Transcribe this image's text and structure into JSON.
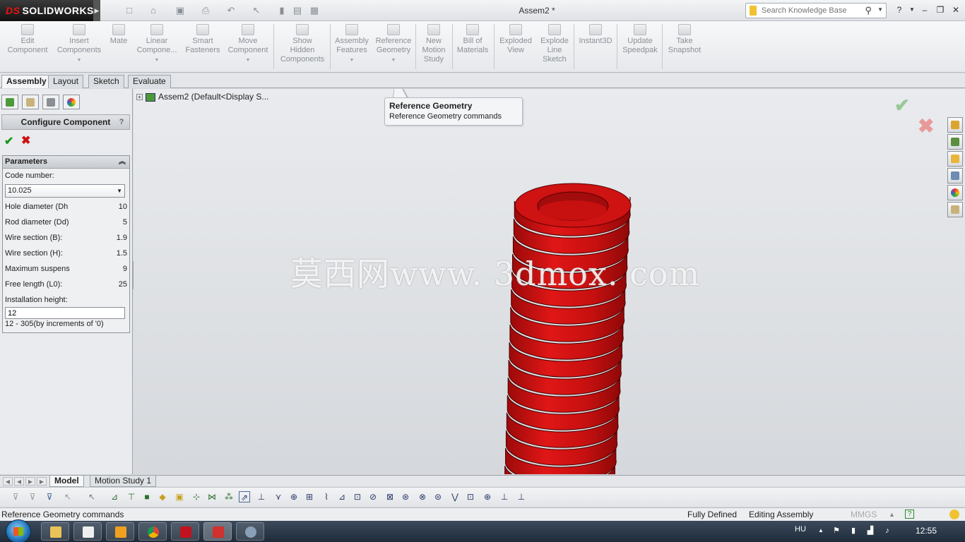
{
  "titlebar": {
    "app_name": "SOLIDWORKS",
    "document_title": "Assem2 *",
    "search_placeholder": "Search Knowledge Base"
  },
  "command_manager": {
    "buttons": [
      {
        "label": "Edit\nComponent",
        "icon": "edit-component-icon"
      },
      {
        "label": "Insert\nComponents",
        "icon": "insert-components-icon"
      },
      {
        "label": "Mate",
        "icon": "mate-icon"
      },
      {
        "label": "Linear\nCompone...",
        "icon": "linear-pattern-icon"
      },
      {
        "label": "Smart\nFasteners",
        "icon": "smart-fasteners-icon"
      },
      {
        "label": "Move\nComponent",
        "icon": "move-component-icon"
      },
      {
        "label": "Show\nHidden\nComponents",
        "icon": "show-hidden-icon"
      },
      {
        "label": "Assembly\nFeatures",
        "icon": "assembly-features-icon"
      },
      {
        "label": "Reference\nGeometry",
        "icon": "reference-geometry-icon"
      },
      {
        "label": "New\nMotion\nStudy",
        "icon": "motion-study-icon"
      },
      {
        "label": "Bill of\nMaterials",
        "icon": "bom-icon"
      },
      {
        "label": "Exploded\nView",
        "icon": "exploded-view-icon"
      },
      {
        "label": "Explode\nLine\nSketch",
        "icon": "explode-line-icon"
      },
      {
        "label": "Instant3D",
        "icon": "instant3d-icon"
      },
      {
        "label": "Update\nSpeedpak",
        "icon": "speedpak-icon"
      },
      {
        "label": "Take\nSnapshot",
        "icon": "snapshot-icon"
      }
    ]
  },
  "tabs": [
    "Assembly",
    "Layout",
    "Sketch",
    "Evaluate"
  ],
  "property_manager": {
    "title": "Configure Component",
    "help": "?",
    "ok": "✔",
    "cancel": "✖",
    "parameters": {
      "header": "Parameters",
      "code_label": "Code number:",
      "code_value": "10.025",
      "rows": [
        {
          "label": "Hole diameter (Dh",
          "value": "10"
        },
        {
          "label": "Rod diameter (Dd)",
          "value": "5"
        },
        {
          "label": "Wire section (B):",
          "value": "1.9"
        },
        {
          "label": "Wire section (H):",
          "value": "1.5"
        },
        {
          "label": "Maximum suspens",
          "value": "9"
        },
        {
          "label": "Free length (L0):",
          "value": "25"
        }
      ],
      "install_label": "Installation height:",
      "install_value": "12",
      "range_text": "12 - 305(by increments of '0)"
    }
  },
  "graphics": {
    "tree_root": "Assem2  (Default<Display S...",
    "tooltip_title": "Reference Geometry",
    "tooltip_desc": "Reference Geometry commands",
    "watermark": "莫西网www. 3dmox. com",
    "spring_color": "#d40f0f"
  },
  "bottom_tabs": [
    "Model",
    "Motion Study 1"
  ],
  "statusbar": {
    "message": "Reference Geometry commands",
    "state": "Fully Defined",
    "mode": "Editing Assembly",
    "units": "MMGS"
  },
  "taskbar": {
    "language": "HU",
    "time": "12:55"
  }
}
